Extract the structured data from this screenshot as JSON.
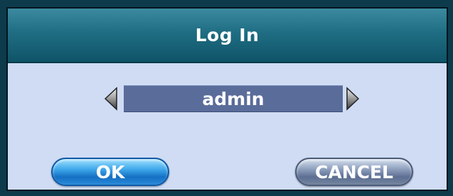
{
  "dialog": {
    "title": "Log In"
  },
  "user_selector": {
    "value": "admin"
  },
  "buttons": {
    "ok_label": "OK",
    "cancel_label": "CANCEL"
  },
  "icons": {
    "left": "arrow-left-icon",
    "right": "arrow-right-icon"
  },
  "colors": {
    "title_bar": "#1f6d83",
    "body": "#cfdcf4",
    "value_box": "#5a6c9a",
    "ok_button": "#3fa8ea",
    "cancel_button": "#8e9fbd"
  }
}
